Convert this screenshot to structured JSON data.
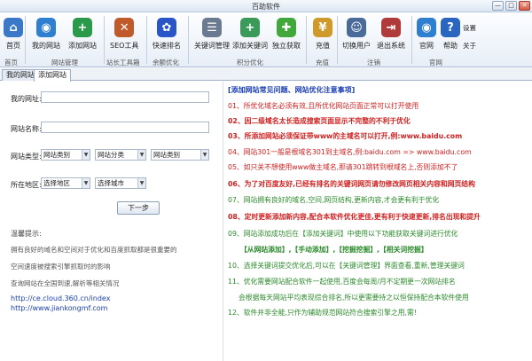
{
  "window": {
    "title": "百助软件",
    "minimize": "—",
    "maximize": "□",
    "close": "✕"
  },
  "toolbar": {
    "buttons": [
      {
        "label": "首页",
        "icon": "home-icon",
        "color": "#3b78c8",
        "glyph": "⌂"
      },
      {
        "label": "我的网站",
        "icon": "globe-icon",
        "color": "#2f7fd0",
        "glyph": "◉"
      },
      {
        "label": "添加网站",
        "icon": "add-globe-icon",
        "color": "#2a9a4a",
        "glyph": "+"
      },
      {
        "label": "SEO工具",
        "icon": "tools-icon",
        "color": "#c05a2a",
        "glyph": "✕"
      },
      {
        "label": "快速排名",
        "icon": "baidu-paw-icon",
        "color": "#2a55c8",
        "glyph": "✿"
      },
      {
        "label": "关键词管理",
        "icon": "keyword-list-icon",
        "color": "#6a7a90",
        "glyph": "☰"
      },
      {
        "label": "添加关键词",
        "icon": "add-keyword-icon",
        "color": "#3a9a5a",
        "glyph": "+"
      },
      {
        "label": "独立获取",
        "icon": "plus-icon",
        "color": "#42a83c",
        "glyph": "✚"
      },
      {
        "label": "充值",
        "icon": "recharge-icon",
        "color": "#d09a2a",
        "glyph": "¥"
      },
      {
        "label": "切换用户",
        "icon": "switch-user-icon",
        "color": "#4a6a9a",
        "glyph": "☺"
      },
      {
        "label": "退出系统",
        "icon": "exit-icon",
        "color": "#b03a3a",
        "glyph": "⇥"
      },
      {
        "label": "官网",
        "icon": "website-icon",
        "color": "#2f7fd0",
        "glyph": "◉"
      },
      {
        "label": "帮助",
        "icon": "help-icon",
        "color": "#2a66c0",
        "glyph": "?"
      }
    ],
    "side": {
      "settings": "设置",
      "about": "关于"
    },
    "groups": [
      "网站管理",
      "站长工具箱",
      "余额优化",
      "积分优化",
      "充值",
      "注销",
      "官网"
    ]
  },
  "tabs": [
    "我的网站",
    "添加网站"
  ],
  "form": {
    "url_label": "我的网址:",
    "name_label": "网站名称:",
    "type_label": "网站类型:",
    "type_selects": [
      "网站类别",
      "网站分类",
      "网站类别"
    ],
    "region_label": "所在地区:",
    "province": "选择地区",
    "city": "选择城市",
    "next": "下一步"
  },
  "tips": {
    "title": "温馨提示:",
    "lines": [
      "拥有良好的域名和空间对于优化和百度抓取都是很重要的",
      "空间速度被搜索引擎抓取时的影响",
      "查询网站在全国到速,解析等相关情况"
    ],
    "links": [
      "http://ce.cloud.360.cn/index",
      "http://www.jiankongmf.com"
    ]
  },
  "notes": {
    "title": "[添加网站常见问题、网站优化注意事项]",
    "items": [
      {
        "text": "01、所优化域名必须有效,且所优化网站页面正常可以打开使用",
        "color": "#d02020"
      },
      {
        "text": "02、因二级域名太长造成搜索页面显示不完整的不利于优化",
        "color": "#d02020"
      },
      {
        "text": "03、所添加网站必须保证带www的主域名可以打开,例:www.baidu.com",
        "color": "#d02020"
      },
      {
        "text": "04、网站301一般是根域名301到主域名,例:baidu.com => www.baidu.com",
        "color": "#d02020"
      },
      {
        "text": "05、如只关不想使用www做主域名,那请301跳转到根域名上,否则添加不了",
        "color": "#d02020"
      },
      {
        "text": "06、为了对百度友好,已经有排名的关键词网页请勿修改网页相关内容和网页结构",
        "color": "#d02020"
      },
      {
        "text": "07、网站拥有良好的域名,空间,网页结构,更新内容,才会更有利于优化",
        "color": "#2a8a2a"
      },
      {
        "text": "08、定时更新添加新内容,配合本软件优化更佳,更有利于快速更新,排名出现和提升",
        "color": "#d02020"
      },
      {
        "text": "09、网站添加成功后在【添加关键词】中使用以下功能获取关键词进行优化",
        "color": "#2a8a2a"
      },
      {
        "text": "【从网站添加】,【手动添加】,【挖掘挖掘】,【相关词挖掘】",
        "color": "#2a8a2a"
      },
      {
        "text": "10、选择关键词提交优化后,可以在【关键词管理】界面查看,重新,管理关键词",
        "color": "#2a8a2a"
      },
      {
        "text": "11、优化需要网站配合软件一起使用,百度会每周/月不定期更一次网站排名",
        "color": "#2a8a2a"
      },
      {
        "text": "会根据每天网站平均表现综合排名,所以更需要持之以恒保持配合本软件使用",
        "color": "#2a8a2a"
      },
      {
        "text": "12、软件并非全能,只作为辅助规范网站符合搜索引擎之用,需!",
        "color": "#2a8a2a"
      }
    ]
  }
}
